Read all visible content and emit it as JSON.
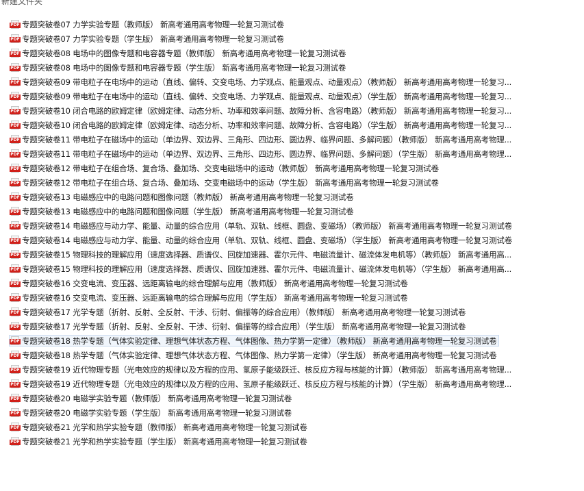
{
  "folder": {
    "title": "新建文件夹"
  },
  "icon": {
    "name": "pdf-file-icon",
    "tag": "PDF",
    "color": "#d0201a"
  },
  "selected_index": 22,
  "files": [
    "专题突破卷07 力学实验专题（教师版） 新高考通用高考物理一轮复习测试卷",
    "专题突破卷07 力学实验专题（学生版） 新高考通用高考物理一轮复习测试卷",
    "专题突破卷08 电场中的图像专题和电容器专题（教师版） 新高考通用高考物理一轮复习测试卷",
    "专题突破卷08 电场中的图像专题和电容器专题（学生版） 新高考通用高考物理一轮复习测试卷",
    "专题突破卷09 带电粒子在电场中的运动（直线、偏转、交变电场、力学观点、能量观点、动量观点）（教师版） 新高考通用高考物理一轮复习...",
    "专题突破卷09 带电粒子在电场中的运动（直线、偏转、交变电场、力学观点、能量观点、动量观点）（学生版） 新高考通用高考物理一轮复习...",
    "专题突破卷10 闭合电路的欧姆定律（欧姆定律、动态分析、功率和效率问题、故障分析、含容电路）（教师版） 新高考通用高考物理一轮复习...",
    "专题突破卷10 闭合电路的欧姆定律（欧姆定律、动态分析、功率和效率问题、故障分析、含容电路）（学生版） 新高考通用高考物理一轮复习...",
    "专题突破卷11 带电粒子在磁场中的运动（单边界、双边界、三角形、四边形、圆边界、临界问题、多解问题）（教师版） 新高考通用高考物理...",
    "专题突破卷11 带电粒子在磁场中的运动（单边界、双边界、三角形、四边形、圆边界、临界问题、多解问题）（学生版） 新高考通用高考物理...",
    "专题突破卷12 带电粒子在组合场、复合场、叠加场、交变电磁场中的运动（教师版） 新高考通用高考物理一轮复习测试卷",
    "专题突破卷12 带电粒子在组合场、复合场、叠加场、交变电磁场中的运动（学生版） 新高考通用高考物理一轮复习测试卷",
    "专题突破卷13 电磁感应中的电路问题和图像问题（教师版） 新高考通用高考物理一轮复习测试卷",
    "专题突破卷13 电磁感应中的电路问题和图像问题（学生版） 新高考通用高考物理一轮复习测试卷",
    "专题突破卷14 电磁感应与动力学、能量、动量的综合应用（单轨、双轨、线框、圆盘、变磁场）（教师版） 新高考通用高考物理一轮复习测试卷",
    "专题突破卷14 电磁感应与动力学、能量、动量的综合应用（单轨、双轨、线框、圆盘、变磁场）（学生版） 新高考通用高考物理一轮复习测试卷",
    "专题突破卷15 物理科技的理解应用（速度选择器、质谱仪、回旋加速器、霍尔元件、电磁流量计、磁流体发电机等）（教师版） 新高考通用高...",
    "专题突破卷15 物理科技的理解应用（速度选择器、质谱仪、回旋加速器、霍尔元件、电磁流量计、磁流体发电机等）（学生版） 新高考通用高...",
    "专题突破卷16 交变电流、变压器、远距离输电的综合理解与应用（教师版） 新高考通用高考物理一轮复习测试卷",
    "专题突破卷16 交变电流、变压器、远距离输电的综合理解与应用（学生版） 新高考通用高考物理一轮复习测试卷",
    "专题突破卷17 光学专题（折射、反射、全反射、干涉、衍射、偏振等的综合应用）（教师版） 新高考通用高考物理一轮复习测试卷",
    "专题突破卷17 光学专题（折射、反射、全反射、干涉、衍射、偏振等的综合应用）（学生版） 新高考通用高考物理一轮复习测试卷",
    "专题突破卷18 热学专题（气体实验定律、理想气体状态方程、气体图像、热力学第一定律）（教师版） 新高考通用高考物理一轮复习测试卷",
    "专题突破卷18 热学专题（气体实验定律、理想气体状态方程、气体图像、热力学第一定律）（学生版） 新高考通用高考物理一轮复习测试卷",
    "专题突破卷19 近代物理专题（光电效应的规律以及方程的应用、氢原子能级跃迁、核反应方程与核能的计算）（教师版） 新高考通用高考物理...",
    "专题突破卷19 近代物理专题（光电效应的规律以及方程的应用、氢原子能级跃迁、核反应方程与核能的计算）（学生版） 新高考通用高考物理...",
    "专题突破卷20 电磁学实验专题（教师版） 新高考通用高考物理一轮复习测试卷",
    "专题突破卷20 电磁学实验专题（学生版） 新高考通用高考物理一轮复习测试卷",
    "专题突破卷21 光学和热学实验专题（教师版） 新高考通用高考物理一轮复习测试卷",
    "专题突破卷21 光学和热学实验专题（学生版） 新高考通用高考物理一轮复习测试卷"
  ]
}
